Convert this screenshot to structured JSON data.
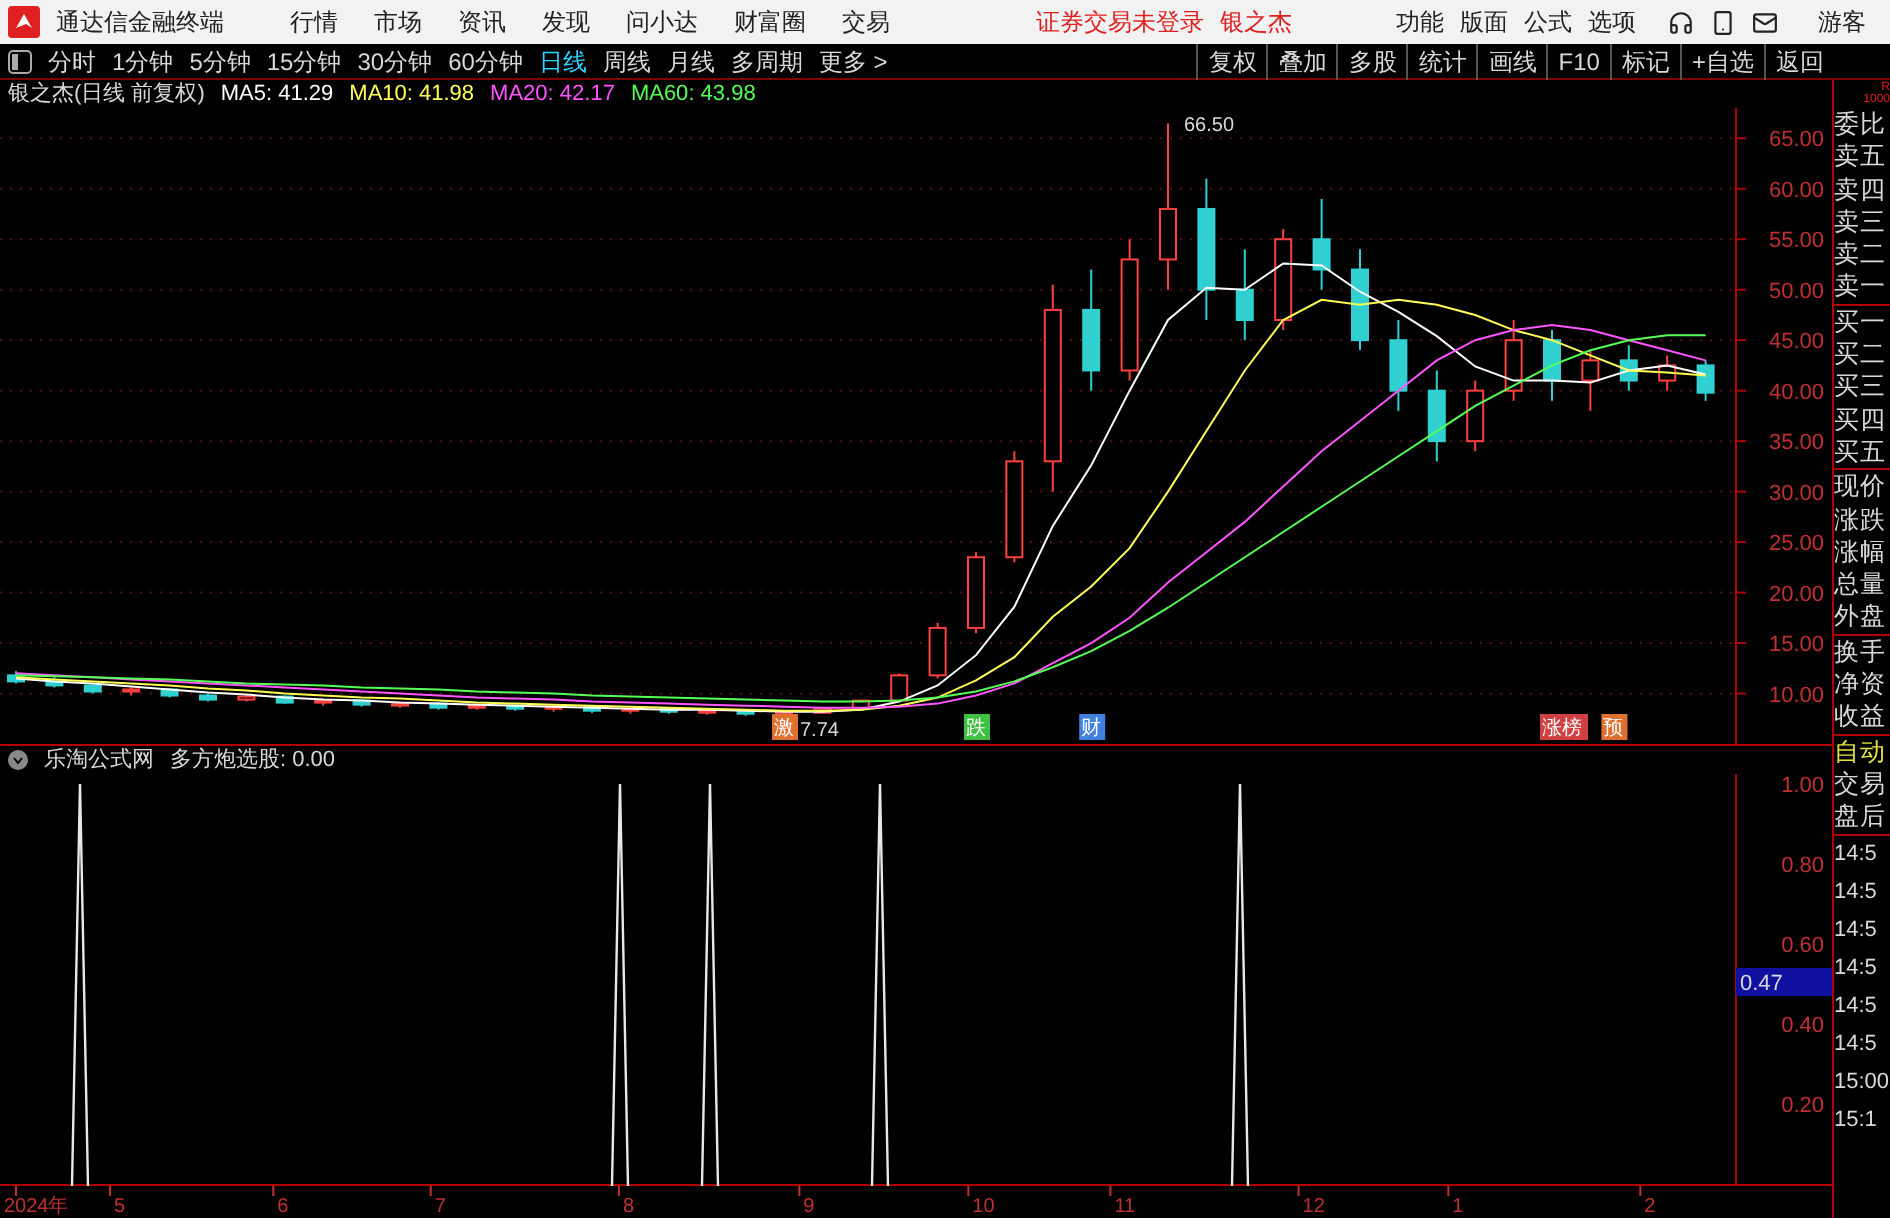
{
  "title_bar": {
    "app_name": "通达信金融终端",
    "menu": [
      "行情",
      "市场",
      "资讯",
      "发现",
      "问小达",
      "财富圈",
      "交易"
    ],
    "login_status": "证券交易未登录",
    "stock_name": "银之杰",
    "right_menu": [
      "功能",
      "版面",
      "公式",
      "选项"
    ],
    "user": "游客"
  },
  "toolbar": {
    "periods": [
      {
        "label": "分时",
        "selected": false
      },
      {
        "label": "1分钟",
        "selected": false
      },
      {
        "label": "5分钟",
        "selected": false
      },
      {
        "label": "15分钟",
        "selected": false
      },
      {
        "label": "30分钟",
        "selected": false
      },
      {
        "label": "60分钟",
        "selected": false
      },
      {
        "label": "日线",
        "selected": true
      },
      {
        "label": "周线",
        "selected": false
      },
      {
        "label": "月线",
        "selected": false
      },
      {
        "label": "多周期",
        "selected": false
      },
      {
        "label": "更多 >",
        "selected": false
      }
    ],
    "actions": [
      "复权",
      "叠加",
      "多股",
      "统计",
      "画线",
      "F10",
      "标记",
      "+自选",
      "返回"
    ]
  },
  "main_chart": {
    "title": "银之杰(日线 前复权)",
    "chart_data": {
      "type": "candlestick",
      "grid": true,
      "ylim": [
        5,
        68
      ],
      "yticks": [
        {
          "value": 65,
          "label": "65.00"
        },
        {
          "value": 60,
          "label": "60.00"
        },
        {
          "value": 55,
          "label": "55.00"
        },
        {
          "value": 50,
          "label": "50.00"
        },
        {
          "value": 45,
          "label": "45.00"
        },
        {
          "value": 40,
          "label": "40.00"
        },
        {
          "value": 35,
          "label": "35.00"
        },
        {
          "value": 30,
          "label": "30.00"
        },
        {
          "value": 25,
          "label": "25.00"
        },
        {
          "value": 20,
          "label": "20.00"
        },
        {
          "value": 15,
          "label": "15.00"
        },
        {
          "value": 10,
          "label": "10.00"
        }
      ],
      "ohlc": [
        [
          11.8,
          12.2,
          11.0,
          11.2
        ],
        [
          11.2,
          11.6,
          10.6,
          10.8
        ],
        [
          10.8,
          11.0,
          10.0,
          10.2
        ],
        [
          10.2,
          10.6,
          9.8,
          10.4
        ],
        [
          10.4,
          10.5,
          9.6,
          9.8
        ],
        [
          9.8,
          10.0,
          9.2,
          9.4
        ],
        [
          9.4,
          9.9,
          9.2,
          9.7
        ],
        [
          9.7,
          9.8,
          9.0,
          9.1
        ],
        [
          9.1,
          9.5,
          8.8,
          9.3
        ],
        [
          9.3,
          9.4,
          8.7,
          8.9
        ],
        [
          8.9,
          9.2,
          8.6,
          9.0
        ],
        [
          9.0,
          9.1,
          8.4,
          8.6
        ],
        [
          8.6,
          9.0,
          8.4,
          8.8
        ],
        [
          8.8,
          8.9,
          8.3,
          8.5
        ],
        [
          8.5,
          8.8,
          8.2,
          8.7
        ],
        [
          8.7,
          8.8,
          8.1,
          8.3
        ],
        [
          8.3,
          8.6,
          8.0,
          8.5
        ],
        [
          8.5,
          8.6,
          8.0,
          8.2
        ],
        [
          8.2,
          8.4,
          7.9,
          8.3
        ],
        [
          8.3,
          8.4,
          7.8,
          8.0
        ],
        [
          8.0,
          8.2,
          7.74,
          8.1
        ],
        [
          8.1,
          8.6,
          8.0,
          8.5
        ],
        [
          8.5,
          9.4,
          8.4,
          9.3
        ],
        [
          9.3,
          12.0,
          9.2,
          11.8
        ],
        [
          11.8,
          17.0,
          11.5,
          16.5
        ],
        [
          16.5,
          24.0,
          16.0,
          23.5
        ],
        [
          23.5,
          34.0,
          23.0,
          33.0
        ],
        [
          33.0,
          50.5,
          30.0,
          48.0
        ],
        [
          48.0,
          52.0,
          40.0,
          42.0
        ],
        [
          42.0,
          55.0,
          41.0,
          53.0
        ],
        [
          53.0,
          66.5,
          50.0,
          58.0
        ],
        [
          58.0,
          61.0,
          47.0,
          50.0
        ],
        [
          50.0,
          54.0,
          45.0,
          47.0
        ],
        [
          47.0,
          56.0,
          46.0,
          55.0
        ],
        [
          55.0,
          59.0,
          50.0,
          52.0
        ],
        [
          52.0,
          54.0,
          44.0,
          45.0
        ],
        [
          45.0,
          47.0,
          38.0,
          40.0
        ],
        [
          40.0,
          42.0,
          33.0,
          35.0
        ],
        [
          35.0,
          41.0,
          34.0,
          40.0
        ],
        [
          40.0,
          47.0,
          39.0,
          45.0
        ],
        [
          45.0,
          46.0,
          39.0,
          41.0
        ],
        [
          41.0,
          44.0,
          38.0,
          43.0
        ],
        [
          43.0,
          44.5,
          40.0,
          41.0
        ],
        [
          41.0,
          43.5,
          40.0,
          42.5
        ],
        [
          42.5,
          43.0,
          39.0,
          39.8
        ]
      ],
      "series": [
        {
          "name": "MA5",
          "type": "line",
          "color": "#ffffff",
          "values": [
            11.5,
            11.2,
            11,
            10.7,
            10.4,
            10.1,
            9.9,
            9.6,
            9.4,
            9.3,
            9.1,
            9.0,
            8.9,
            8.8,
            8.7,
            8.6,
            8.5,
            8.4,
            8.4,
            8.3,
            8.2,
            8.2,
            8.4,
            9.2,
            10.8,
            13.8,
            18.6,
            26.6,
            32.6,
            40.0,
            47.0,
            50.2,
            50.0,
            52.6,
            52.4,
            49.8,
            47.8,
            45.4,
            42.4,
            41.0,
            41.0,
            40.8,
            42.0,
            42.5,
            41.6
          ]
        },
        {
          "name": "MA10",
          "type": "line",
          "color": "#ffff55",
          "values": [
            11.6,
            11.4,
            11.2,
            11,
            10.8,
            10.5,
            10.3,
            10.0,
            9.8,
            9.6,
            9.5,
            9.3,
            9.1,
            9.0,
            8.9,
            8.8,
            8.7,
            8.6,
            8.5,
            8.4,
            8.3,
            8.3,
            8.4,
            8.8,
            9.6,
            11.3,
            13.6,
            17.6,
            20.6,
            24.4,
            30.0,
            36.0,
            42.0,
            47.0,
            49.0,
            48.5,
            49.0,
            48.5,
            47.5,
            46.0,
            45.0,
            43.5,
            42.0,
            41.8,
            41.5
          ]
        },
        {
          "name": "MA20",
          "type": "line",
          "color": "#ff55ff",
          "values": [
            12,
            11.8,
            11.6,
            11.4,
            11.2,
            11,
            10.8,
            10.6,
            10.4,
            10.2,
            10,
            9.8,
            9.6,
            9.5,
            9.4,
            9.2,
            9.1,
            9.0,
            8.9,
            8.8,
            8.7,
            8.6,
            8.6,
            8.7,
            9.0,
            9.8,
            11.0,
            13.0,
            15.0,
            17.5,
            21,
            24,
            27,
            30.5,
            34,
            37,
            40,
            43,
            45,
            46,
            46.5,
            46,
            45,
            44,
            43
          ]
        },
        {
          "name": "MA60",
          "type": "line",
          "color": "#55ff55",
          "values": [
            11.8,
            11.7,
            11.6,
            11.5,
            11.4,
            11.2,
            11.0,
            10.9,
            10.8,
            10.6,
            10.5,
            10.4,
            10.2,
            10.1,
            10.0,
            9.8,
            9.7,
            9.6,
            9.5,
            9.4,
            9.3,
            9.2,
            9.2,
            9.3,
            9.6,
            10.2,
            11.2,
            12.6,
            14.2,
            16.2,
            18.5,
            21,
            23.5,
            26,
            28.5,
            31,
            33.5,
            36,
            38.5,
            40.5,
            42.5,
            44,
            45,
            45.5,
            45.5
          ]
        }
      ],
      "annotations": [
        "66.50",
        "7.74"
      ]
    },
    "legend_readings": [
      ": 41.29",
      ": 41.98",
      ": 42.17",
      ": 43.98"
    ],
    "markers": [
      {
        "label": "激",
        "color": "#e07030"
      },
      {
        "label": "跌",
        "color": "#40c040"
      },
      {
        "label": "财",
        "color": "#4080e0"
      },
      {
        "label": "涨榜",
        "color": "#d04040"
      },
      {
        "label": "预",
        "color": "#e07030"
      }
    ]
  },
  "time_axis": [
    "2024年",
    "5",
    "6",
    "7",
    "8",
    "9",
    "10",
    "11",
    "12",
    "1",
    "2"
  ],
  "indicator": {
    "title": "乐淘公式网",
    "formula": "多方炮选股: 0.00",
    "yticks": [
      "1.00",
      "0.80",
      "0.60",
      "0.40",
      "0.20"
    ],
    "cursor_value": "0.47"
  },
  "side_panel": {
    "corner": [
      "R",
      "1000"
    ],
    "quote_labels": [
      "委比",
      "卖五",
      "卖四",
      "卖三",
      "卖二",
      "卖一",
      "买一",
      "买二",
      "买三",
      "买四",
      "买五",
      "现价",
      "涨跌",
      "涨幅",
      "总量",
      "外盘",
      "换手",
      "净资",
      "收益"
    ],
    "mode": "自动",
    "trade_labels": [
      "交易",
      "盘后"
    ],
    "times": [
      "14:5",
      "14:5",
      "14:5",
      "14:5",
      "14:5",
      "14:5",
      "15:00",
      "15:1"
    ]
  }
}
